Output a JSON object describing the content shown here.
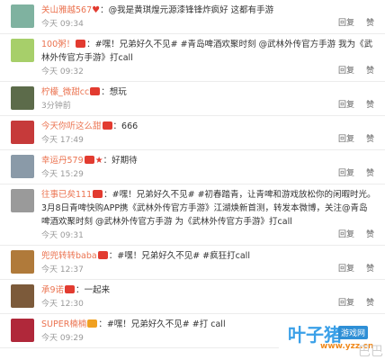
{
  "comments": [
    {
      "name": "关山雅越567",
      "avatar_color": "#7fb2a0",
      "badges": [
        "heart"
      ],
      "content": "@我是黄琪煌元源漆锋锋炸疯好 这都有手游",
      "time": "今天 09:34"
    },
    {
      "name": "100粥！",
      "avatar_color": "#a7cf6a",
      "badges": [
        "v-red"
      ],
      "content": "#嘿！兄弟好久不见# #青岛啤酒欢聚时刻 @武林外传官方手游 我为《武林外传官方手游》打call",
      "time": "今天 09:32"
    },
    {
      "name": "柠檬_微甜cc",
      "avatar_color": "#5c6b4a",
      "badges": [
        "v-red"
      ],
      "content": "想玩",
      "time": "3分钟前"
    },
    {
      "name": "今天你听这么甜",
      "avatar_color": "#c63a3a",
      "badges": [
        "v-red"
      ],
      "content": "666",
      "time": "今天 17:49"
    },
    {
      "name": "幸运丹579",
      "avatar_color": "#8a9aa8",
      "badges": [
        "v-red",
        "star"
      ],
      "content": "好期待",
      "time": "今天 15:29"
    },
    {
      "name": "往事已矣111",
      "avatar_color": "#9a9a9a",
      "badges": [
        "v-red"
      ],
      "content": "#嘿！兄弟好久不见# #初春踏青，让青啤和游戏放松你的闲暇时光。3月8日青啤快购APP携《武林外传官方手游》江湖焕新首测，转发本微博，关注@青岛啤酒欢聚时刻 @武林外传官方手游 为《武林外传官方手游》打call",
      "time": "今天 09:31"
    },
    {
      "name": "兜兜转转baba",
      "avatar_color": "#b07a3a",
      "badges": [
        "v-red"
      ],
      "content": "#嘿！兄弟好久不见# #疯狂打call",
      "time": "今天 12:37"
    },
    {
      "name": "承9诺",
      "avatar_color": "#7c5a3a",
      "badges": [
        "v-red"
      ],
      "content": "一起来",
      "time": "今天 12:30"
    },
    {
      "name": "SUPER楠楠",
      "avatar_color": "#b0283a",
      "badges": [
        "v-gold"
      ],
      "content": "#嘿！兄弟好久不见# #打 call",
      "time": "今天 09:29"
    }
  ],
  "actions": {
    "reply": "回复",
    "like": "赞"
  },
  "logo": {
    "main": "叶子猪",
    "sub": "游戏网",
    "url": "www.yzz.cn"
  },
  "watermark": "巴巴"
}
